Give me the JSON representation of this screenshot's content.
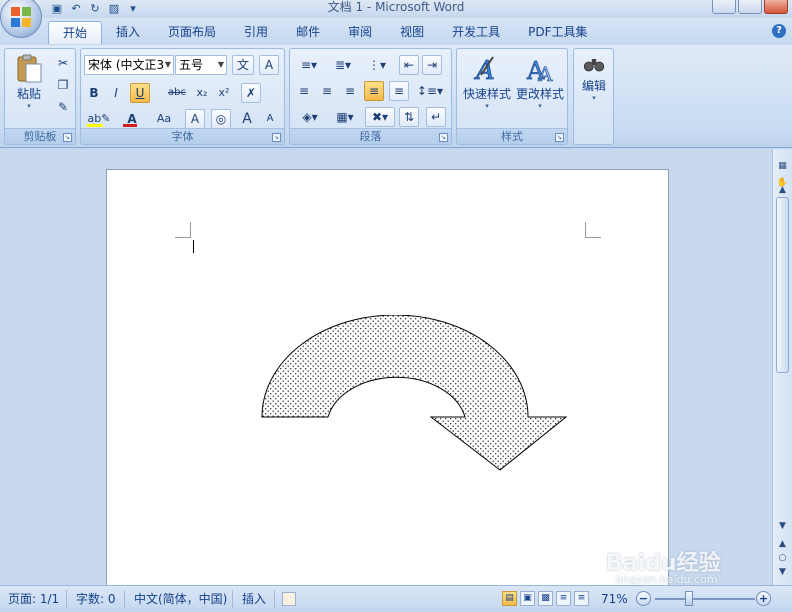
{
  "window": {
    "title": "文档 1 - Microsoft Word"
  },
  "tabs": [
    "开始",
    "插入",
    "页面布局",
    "引用",
    "邮件",
    "审阅",
    "视图",
    "开发工具",
    "PDF工具集"
  ],
  "ribbon": {
    "clipboard": {
      "paste_label": "粘贴",
      "group_label": "剪贴板"
    },
    "font": {
      "font_name": "宋体 (中文正3",
      "font_size": "五号",
      "bold": "B",
      "italic": "I",
      "underline": "U",
      "strike": "abc",
      "sub": "x₂",
      "sup": "x²",
      "case": "Aa",
      "grow": "A",
      "shrink": "A",
      "group_label": "字体"
    },
    "paragraph": {
      "group_label": "段落"
    },
    "styles": {
      "quick_styles_label": "快速样式",
      "change_styles_label": "更改样式",
      "group_label": "样式"
    },
    "editing": {
      "edit_label": "编辑"
    }
  },
  "statusbar": {
    "page": "页面: 1/1",
    "words": "字数: 0",
    "language": "中文(简体，中国)",
    "mode": "插入",
    "zoom": "71%",
    "zoom_level": 0.71
  },
  "colors": {
    "accent": "#15428b",
    "highlight": "#f6b94a",
    "font_color": "#d02020",
    "highlight_yellow": "#ffff00"
  },
  "watermark": {
    "brand": "Baidu经验",
    "url": "jingyan.baidu.com"
  }
}
